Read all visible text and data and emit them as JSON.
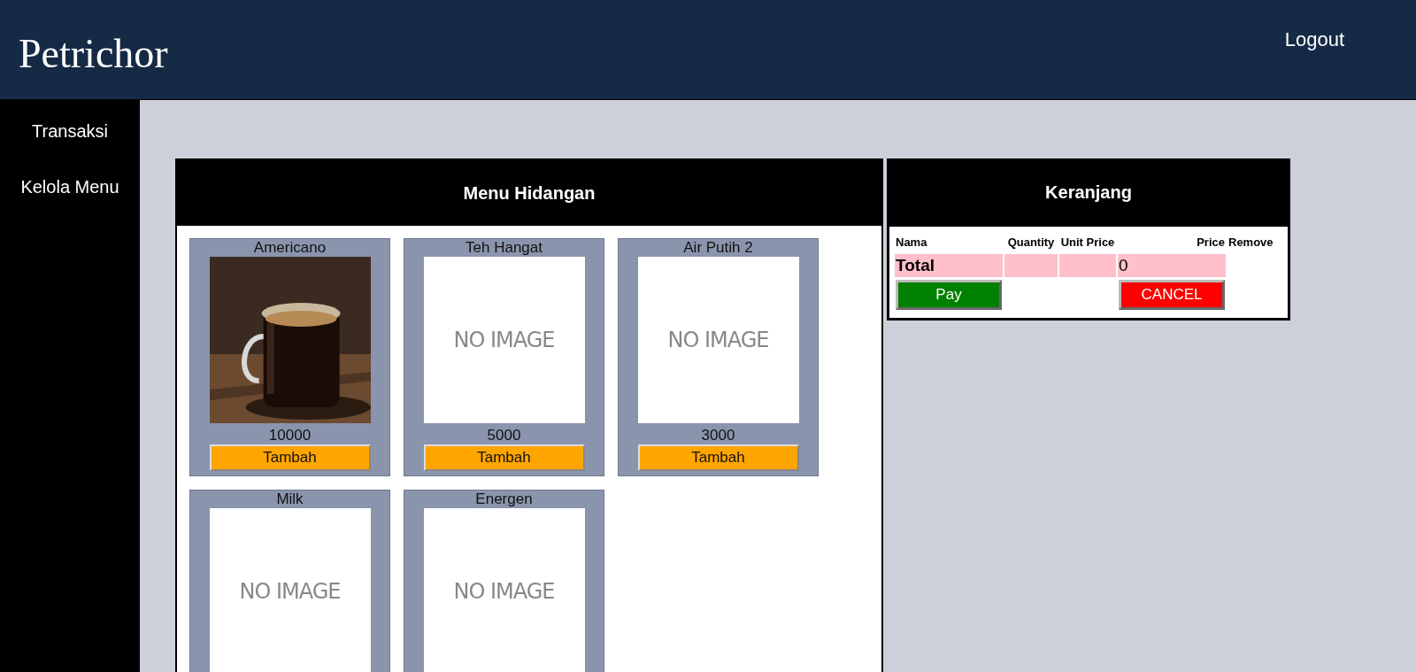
{
  "header": {
    "brand": "Petrichor",
    "logout": "Logout"
  },
  "sidebar": {
    "items": [
      {
        "label": "Transaksi"
      },
      {
        "label": "Kelola Menu"
      }
    ]
  },
  "menu": {
    "title": "Menu Hidangan",
    "items": [
      {
        "name": "Americano",
        "price": "10000",
        "button": "Tambah"
      },
      {
        "name": "Teh Hangat",
        "image": {
          "kind": "placeholder",
          "text": "NO IMAGE"
        },
        "price": "5000",
        "button": "Tambah"
      },
      {
        "name": "Air Putih 2",
        "image": {
          "kind": "placeholder",
          "text": "NO IMAGE"
        },
        "price": "3000",
        "button": "Tambah"
      },
      {
        "name": "Milk",
        "image": {
          "kind": "placeholder",
          "text": "NO IMAGE"
        }
      },
      {
        "name": "Energen",
        "image": {
          "kind": "placeholder",
          "text": "NO IMAGE"
        }
      }
    ]
  },
  "cart": {
    "title": "Keranjang",
    "columns": [
      "Nama",
      "Quantity",
      "Unit Price",
      "Price",
      "Remove"
    ],
    "total": {
      "label": "Total",
      "value": "0"
    },
    "pay": "Pay",
    "cancel": "CANCEL"
  }
}
